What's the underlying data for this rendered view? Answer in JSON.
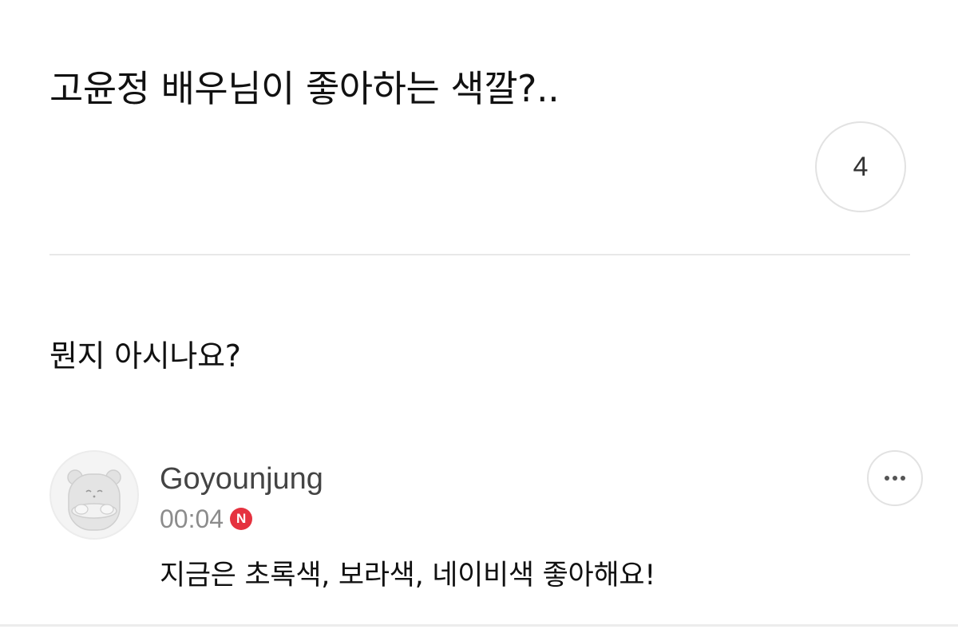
{
  "post": {
    "title": "고윤정 배우님이 좋아하는 색깔?..",
    "comment_count": "4",
    "body": "뭔지 아시나요?"
  },
  "comment": {
    "author": "Goyounjung",
    "time": "00:04",
    "new_badge": "N",
    "text": "지금은 초록색, 보라색, 네이비색 좋아해요!",
    "avatar_icon": "hamster-avatar-icon",
    "more_icon": "more-horizontal-icon"
  },
  "colors": {
    "new_badge": "#e5323f",
    "divider": "#e8e8e8",
    "muted_text": "#8c8c8c"
  }
}
